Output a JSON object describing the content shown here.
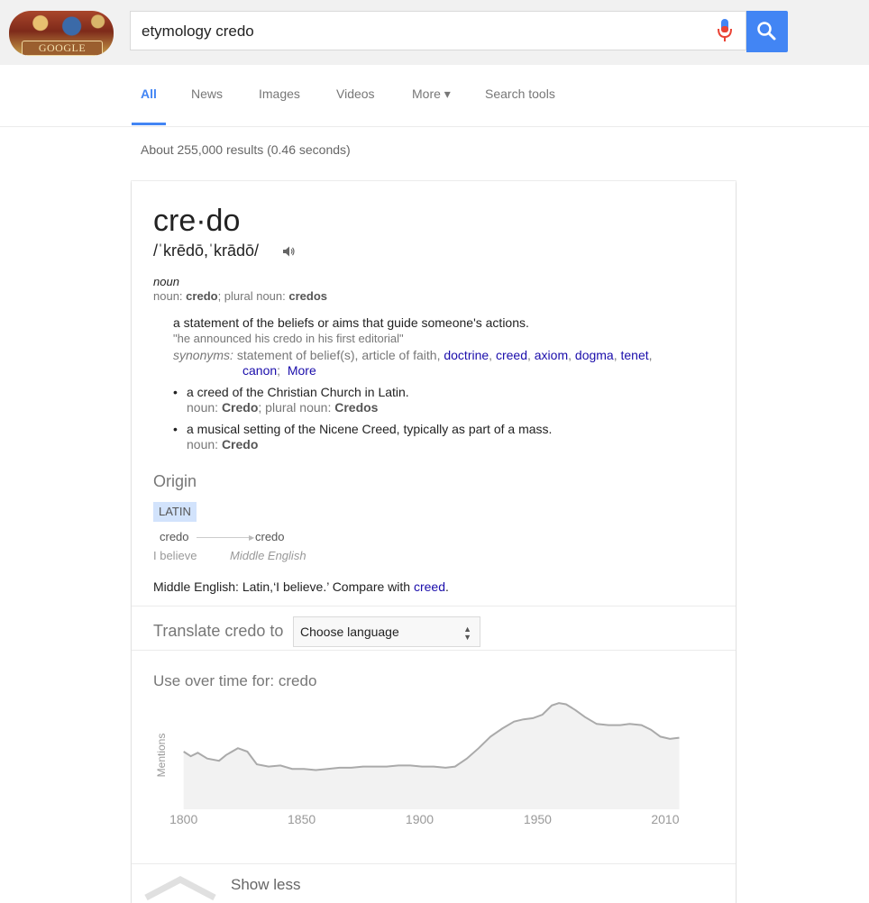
{
  "logo": {
    "text": "GOOGLE"
  },
  "search": {
    "query": "etymology credo"
  },
  "tabs": [
    {
      "label": "All",
      "active": true
    },
    {
      "label": "News"
    },
    {
      "label": "Images"
    },
    {
      "label": "Videos"
    },
    {
      "label": "More ▾"
    },
    {
      "label": "Search tools"
    }
  ],
  "result_stats": "About 255,000 results (0.46 seconds)",
  "dictionary": {
    "headword": "cre·do",
    "phonetic": "/ˈkrēdō,ˈkrādō/",
    "part_of_speech": "noun",
    "inflection_label": "noun:",
    "inflection_word": "credo",
    "inflection_plural_label": "; plural noun:",
    "inflection_plural": "credos",
    "definition": "a statement of the beliefs or aims that guide someone's actions.",
    "example": "\"he announced his credo in his first editorial\"",
    "synonyms_label": "synonyms:",
    "synonyms_plain": "statement of belief(s), article of faith,",
    "synonyms_links": [
      "doctrine",
      "creed",
      "axiom",
      "dogma",
      "tenet",
      "canon"
    ],
    "synonyms_more": "More",
    "sub_definitions": [
      {
        "text": "a creed of the Christian Church in Latin.",
        "inf_label": "noun:",
        "inf_word": "Credo",
        "inf_plural_label": "; plural noun:",
        "inf_plural": "Credos"
      },
      {
        "text": "a musical setting of the Nicene Creed, typically as part of a mass.",
        "inf_label": "noun:",
        "inf_word": "Credo",
        "inf_plural_label": "",
        "inf_plural": ""
      }
    ]
  },
  "origin": {
    "title": "Origin",
    "language_tag": "LATIN",
    "from_word": "credo",
    "from_gloss": "I believe",
    "to_word": "credo",
    "to_gloss": "Middle English",
    "text_prefix": "Middle English: Latin,‘I believe.’ Compare with",
    "compare_link": "creed",
    "text_suffix": "."
  },
  "translate": {
    "label": "Translate credo to",
    "select_value": "Choose language"
  },
  "usage": {
    "title": "Use over time for: credo"
  },
  "chart_data": {
    "type": "area",
    "title": "Use over time for: credo",
    "ylabel": "Mentions",
    "xlabel": "",
    "x_ticks": [
      "1800",
      "1850",
      "1900",
      "1950",
      "2010"
    ],
    "xlim": [
      1794,
      2014
    ],
    "ylim": [
      0,
      1
    ],
    "grid": false,
    "series": [
      {
        "values": [
          [
            1800,
            0.5
          ],
          [
            1803,
            0.46
          ],
          [
            1806,
            0.49
          ],
          [
            1810,
            0.44
          ],
          [
            1815,
            0.42
          ],
          [
            1818,
            0.47
          ],
          [
            1823,
            0.53
          ],
          [
            1827,
            0.5
          ],
          [
            1831,
            0.39
          ],
          [
            1836,
            0.37
          ],
          [
            1841,
            0.38
          ],
          [
            1846,
            0.35
          ],
          [
            1851,
            0.35
          ],
          [
            1856,
            0.34
          ],
          [
            1861,
            0.35
          ],
          [
            1866,
            0.36
          ],
          [
            1871,
            0.36
          ],
          [
            1876,
            0.37
          ],
          [
            1881,
            0.37
          ],
          [
            1886,
            0.37
          ],
          [
            1891,
            0.38
          ],
          [
            1896,
            0.38
          ],
          [
            1901,
            0.37
          ],
          [
            1906,
            0.37
          ],
          [
            1911,
            0.36
          ],
          [
            1915,
            0.37
          ],
          [
            1920,
            0.44
          ],
          [
            1925,
            0.53
          ],
          [
            1930,
            0.63
          ],
          [
            1935,
            0.7
          ],
          [
            1940,
            0.76
          ],
          [
            1944,
            0.78
          ],
          [
            1948,
            0.79
          ],
          [
            1952,
            0.82
          ],
          [
            1956,
            0.9
          ],
          [
            1959,
            0.92
          ],
          [
            1962,
            0.91
          ],
          [
            1966,
            0.86
          ],
          [
            1970,
            0.8
          ],
          [
            1975,
            0.74
          ],
          [
            1980,
            0.73
          ],
          [
            1985,
            0.73
          ],
          [
            1989,
            0.74
          ],
          [
            1994,
            0.73
          ],
          [
            1998,
            0.69
          ],
          [
            2002,
            0.63
          ],
          [
            2006,
            0.61
          ],
          [
            2010,
            0.62
          ]
        ]
      }
    ]
  },
  "show_less": {
    "label": "Show less"
  },
  "colors": {
    "accent": "#4285f4",
    "link": "#1a0dab",
    "chart_line": "#aaaaaa",
    "chart_fill": "#f2f2f2",
    "tag_bg": "#d2e3fc"
  },
  "icons": {
    "mic": "microphone-icon",
    "search": "search-icon",
    "speaker": "speaker-icon",
    "chevron": "chevron-up-icon"
  }
}
